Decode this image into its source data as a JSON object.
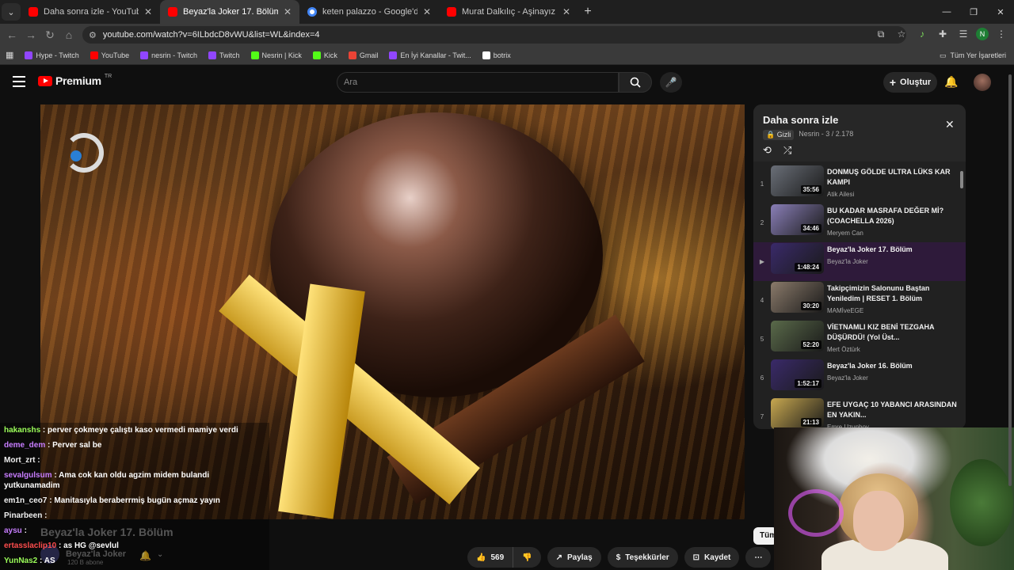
{
  "browser": {
    "tabs": [
      {
        "title": "Daha sonra izle - YouTube",
        "favicon": "youtube-icon",
        "active": false
      },
      {
        "title": "Beyaz'la Joker 17. Bölüm - YouT",
        "favicon": "youtube-icon",
        "active": true
      },
      {
        "title": "keten palazzo - Google'da Ara",
        "favicon": "google-icon",
        "active": false
      },
      {
        "title": "Murat Dalkılıç - Aşinayız ft. Oğu",
        "favicon": "youtube-icon",
        "active": false
      }
    ],
    "url": "youtube.com/watch?v=6ILbdcD8vWU&list=WL&index=4",
    "profile_initial": "N",
    "bookmarks": [
      {
        "label": "Hype - Twitch",
        "color": "#9146ff"
      },
      {
        "label": "YouTube",
        "color": "#ff0000"
      },
      {
        "label": "nesrin - Twitch",
        "color": "#9146ff"
      },
      {
        "label": "Twitch",
        "color": "#9146ff"
      },
      {
        "label": "Nesrin | Kick",
        "color": "#53fc18"
      },
      {
        "label": "Kick",
        "color": "#53fc18"
      },
      {
        "label": "Gmail",
        "color": "#ea4335"
      },
      {
        "label": "En İyi Kanallar - Twit...",
        "color": "#9146ff"
      },
      {
        "label": "botrix",
        "color": "#ffffff"
      }
    ],
    "bookmarks_folder": "Tüm Yer İşaretleri"
  },
  "youtube": {
    "logo_text": "Premium",
    "region": "TR",
    "search_placeholder": "Ara",
    "create_label": "Oluştur",
    "video": {
      "title": "Beyaz'la Joker 17. Bölüm",
      "channel": "Beyaz'la Joker",
      "subscribers": "120 B abone",
      "likes": "569",
      "share_label": "Paylaş",
      "thanks_label": "Teşekkürler",
      "save_label": "Kaydet"
    },
    "all_button": "Tüm"
  },
  "playlist": {
    "title": "Daha sonra izle",
    "privacy": "Gizli",
    "owner_progress": "Nesrin - 3 / 2.178",
    "items": [
      {
        "index": "1",
        "title": "DONMUŞ GÖLDE ULTRA LÜKS KAR KAMPI",
        "channel": "Atik Ailesi",
        "duration": "35:56",
        "thumb": "#6a6f78"
      },
      {
        "index": "2",
        "title": "BU KADAR MASRAFA DEĞER Mİ? (COACHELLA 2026)",
        "channel": "Meryem Can",
        "duration": "34:46",
        "thumb": "#8a7fb8"
      },
      {
        "index": "▶",
        "title": "Beyaz'la Joker 17. Bölüm",
        "channel": "Beyaz'la Joker",
        "duration": "1:48:24",
        "thumb": "#3a2a6a",
        "current": true
      },
      {
        "index": "4",
        "title": "Takipçimizin Salonunu Baştan Yeniledim | RESET 1. Bölüm",
        "channel": "MAMİveEGE",
        "duration": "30:20",
        "thumb": "#8a7a6a"
      },
      {
        "index": "5",
        "title": "VİETNAMLI KIZ BENİ TEZGAHA DÜŞÜRDÜ! (Yol Üst...",
        "channel": "Mert Öztürk",
        "duration": "52:20",
        "thumb": "#5a6a4a"
      },
      {
        "index": "6",
        "title": "Beyaz'la Joker 16. Bölüm",
        "channel": "Beyaz'la Joker",
        "duration": "1:52:17",
        "thumb": "#3a2a6a"
      },
      {
        "index": "7",
        "title": "EFE UYGAÇ 10 YABANCI ARASINDAN EN YAKIN...",
        "channel": "Emre Uzunboy",
        "duration": "21:13",
        "thumb": "#c8a850"
      }
    ]
  },
  "chat": [
    {
      "user": "hakanshs",
      "color": "#9cff5a",
      "message": "perver çokmeye çalıştı kaso vermedi mamiye verdi"
    },
    {
      "user": "deme_dem",
      "color": "#c77dff",
      "message": "Perver sal be"
    },
    {
      "user": "Mort_zrt",
      "color": "#f0f0f0",
      "message": ""
    },
    {
      "user": "sevalgulsum",
      "color": "#c77dff",
      "message": "Ama cok kan oldu agzim midem bulandi yutkunamadim"
    },
    {
      "user": "em1n_ceo7",
      "color": "#f0f0f0",
      "message": "Manitasıyla beraberrmiş bugün açmaz yayın"
    },
    {
      "user": "Pinarbeen",
      "color": "#f0f0f0",
      "message": ""
    },
    {
      "user": "aysu",
      "color": "#c77dff",
      "message": ""
    },
    {
      "user": "ertasslaclip10",
      "color": "#ff4d4d",
      "message": "as HG @sevlul"
    },
    {
      "user": "YunNas2",
      "color": "#9cff5a",
      "message": "AS"
    }
  ]
}
